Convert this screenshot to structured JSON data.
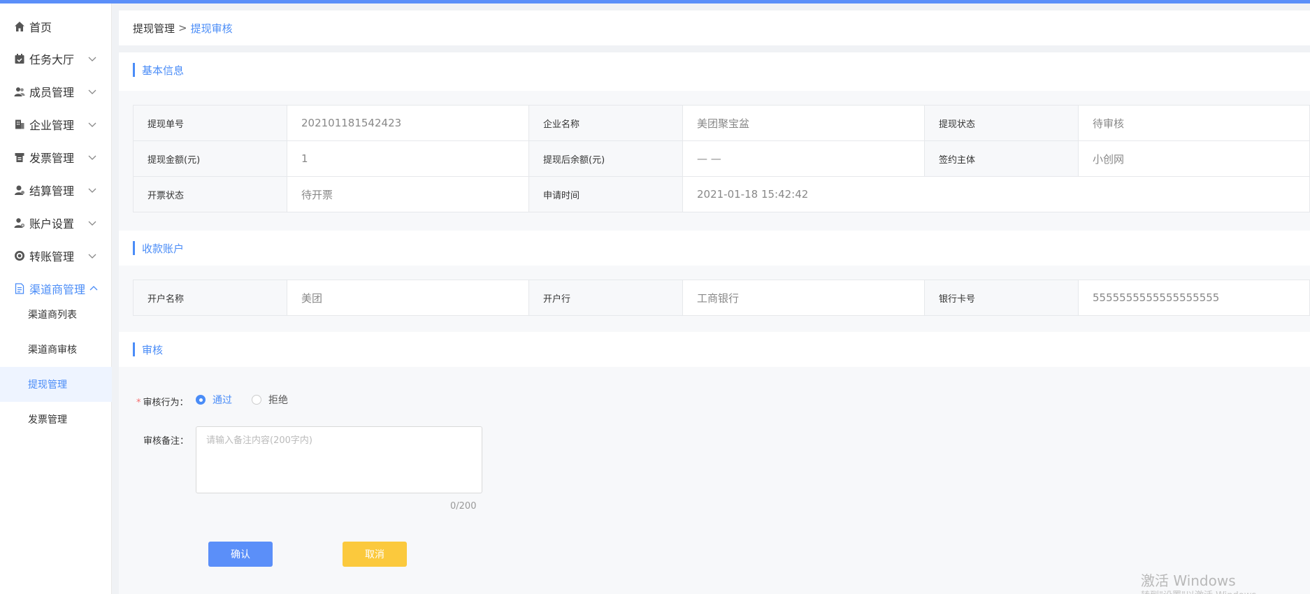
{
  "sidebar": {
    "items": [
      {
        "label": "首页",
        "icon": "home-icon"
      },
      {
        "label": "任务大厅",
        "icon": "calendar-icon"
      },
      {
        "label": "成员管理",
        "icon": "users-icon"
      },
      {
        "label": "企业管理",
        "icon": "building-icon"
      },
      {
        "label": "发票管理",
        "icon": "invoice-icon"
      },
      {
        "label": "结算管理",
        "icon": "settlement-icon"
      },
      {
        "label": "账户设置",
        "icon": "user-settings-icon"
      },
      {
        "label": "转账管理",
        "icon": "transfer-icon"
      },
      {
        "label": "渠道商管理",
        "icon": "document-icon"
      }
    ],
    "sub_items": [
      {
        "label": "渠道商列表"
      },
      {
        "label": "渠道商审核"
      },
      {
        "label": "提现管理"
      },
      {
        "label": "发票管理"
      }
    ]
  },
  "breadcrumb": {
    "parent": "提现管理",
    "separator": ">",
    "current": "提现审核"
  },
  "basic_info": {
    "title": "基本信息",
    "rows": [
      [
        {
          "k": "提现单号",
          "v": "202101181542423"
        },
        {
          "k": "企业名称",
          "v": "美团聚宝盆"
        },
        {
          "k": "提现状态",
          "v": "待审核"
        }
      ],
      [
        {
          "k": "提现金额(元)",
          "v": "1"
        },
        {
          "k": "提现后余额(元)",
          "v": "— —"
        },
        {
          "k": "签约主体",
          "v": "小创网"
        }
      ],
      [
        {
          "k": "开票状态",
          "v": "待开票"
        },
        {
          "k": "申请时间",
          "v": "2021-01-18 15:42:42"
        }
      ]
    ]
  },
  "account": {
    "title": "收款账户",
    "row": [
      {
        "k": "开户名称",
        "v": "美团"
      },
      {
        "k": "开户行",
        "v": "工商银行"
      },
      {
        "k": "银行卡号",
        "v": "5555555555555555555"
      }
    ]
  },
  "review": {
    "title": "审核",
    "action_label": "审核行为：",
    "required_mark": "*",
    "options": [
      "通过",
      "拒绝"
    ],
    "selected": "通过",
    "remark_label": "审核备注：",
    "remark_placeholder": "请输入备注内容(200字内)",
    "remark_value": "",
    "counter": "0/200",
    "confirm_label": "确认",
    "cancel_label": "取消"
  },
  "watermark": {
    "title": "激活 Windows",
    "sub": "转到\"设置\"以激活 Windows。"
  },
  "colors": {
    "accent": "#4a8cf7",
    "confirm": "#5b8ff9",
    "cancel": "#fbc93d"
  }
}
